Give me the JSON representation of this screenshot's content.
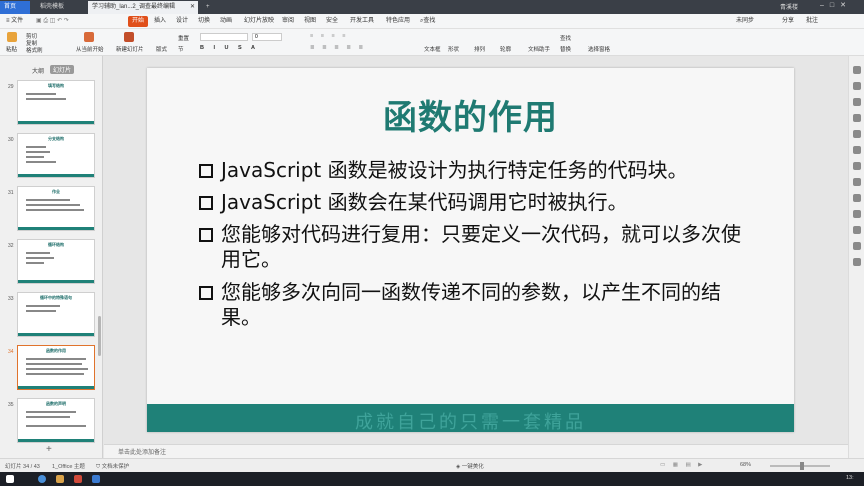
{
  "tabs": {
    "home": "首页",
    "template": "稻壳模板",
    "document": "学习辅助_lan...2_调查最终编辑",
    "new_tab": "+"
  },
  "menu": {
    "file": "≡ 文件",
    "items": [
      "开始",
      "插入",
      "设计",
      "切换",
      "动画",
      "幻灯片放映",
      "审阅",
      "视图",
      "安全",
      "开发工具",
      "特色应用"
    ],
    "search": "查找",
    "right_items": [
      "未同步",
      "分享",
      "批注"
    ],
    "user": "青溪楼"
  },
  "ribbon": {
    "paste": "粘贴",
    "cut": "剪切",
    "copy": "复制",
    "format_painter": "格式刷",
    "from_current": "从当前开始",
    "new_slide": "新建幻灯片",
    "layout": "版式",
    "reset": "重置",
    "section": "节",
    "font_size": "0",
    "textbox": "文本框",
    "shape": "形状",
    "arrange": "排列",
    "outline": "轮廓",
    "find": "查找",
    "replace": "替换",
    "select_pane": "选择窗格",
    "doc_assist": "文档助手"
  },
  "thumbpane": {
    "tab_outline": "大纲",
    "tab_slides": "幻灯片",
    "slides": [
      {
        "num": "29",
        "title": "填写结构"
      },
      {
        "num": "30",
        "title": "分支结构"
      },
      {
        "num": "31",
        "title": "作业"
      },
      {
        "num": "32",
        "title": "循环结构"
      },
      {
        "num": "33",
        "title": "循环中的特殊语句"
      },
      {
        "num": "34",
        "title": "函数的作用"
      },
      {
        "num": "35",
        "title": "函数的声明"
      }
    ],
    "add": "+"
  },
  "slide": {
    "title": "函数的作用",
    "bullets": [
      "JavaScript 函数是被设计为执行特定任务的代码块。",
      "JavaScript 函数会在某代码调用它时被执行。",
      "您能够对代码进行复用：只要定义一次代码，就可以多次使用它。",
      "您能够多次向同一函数传递不同的参数，以产生不同的结果。"
    ],
    "footer": "成就自己的只需一套精品"
  },
  "notes": {
    "placeholder": "单击此处添加备注"
  },
  "status": {
    "slide_count": "幻灯片 34 / 43",
    "theme": "1_Office 主题",
    "protect": "文档未保护",
    "beautify": "一键美化",
    "zoom": "68%"
  },
  "taskbar": {
    "time": "13:"
  },
  "colors": {
    "accent": "#1f7a72",
    "brand": "#e04f1a"
  }
}
